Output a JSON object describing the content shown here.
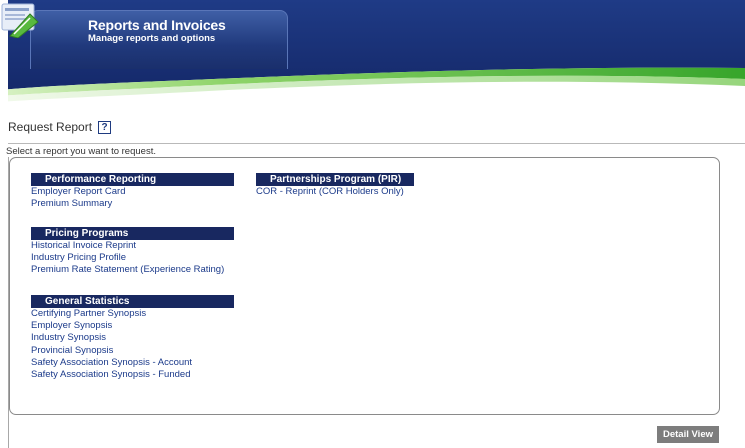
{
  "header": {
    "title": "Reports and Invoices",
    "subtitle": "Manage reports and options"
  },
  "request": {
    "title": "Request Report",
    "help": "?",
    "instructions": "Select a report you want to request."
  },
  "groups": {
    "performance": {
      "heading": "Performance Reporting",
      "items": [
        "Employer Report Card",
        "Premium Summary"
      ]
    },
    "pricing": {
      "heading": "Pricing Programs",
      "items": [
        "Historical Invoice Reprint",
        "Industry Pricing Profile",
        "Premium Rate Statement (Experience Rating)"
      ]
    },
    "general": {
      "heading": "General Statistics",
      "items": [
        "Certifying Partner Synopsis",
        "Employer Synopsis",
        "Industry Synopsis",
        "Provincial Synopsis",
        "Safety Association Synopsis - Account",
        "Safety Association Synopsis - Funded"
      ]
    },
    "partnerships": {
      "heading": "Partnerships Program (PIR)",
      "items": [
        "COR - Reprint (COR Holders Only)"
      ]
    }
  },
  "actions": {
    "detail_view": "Detail View"
  },
  "colors": {
    "banner_blue": "#1d3a86",
    "banner_green": "#5bbf3a",
    "group_header": "#182860",
    "link": "#1b3a8a"
  }
}
